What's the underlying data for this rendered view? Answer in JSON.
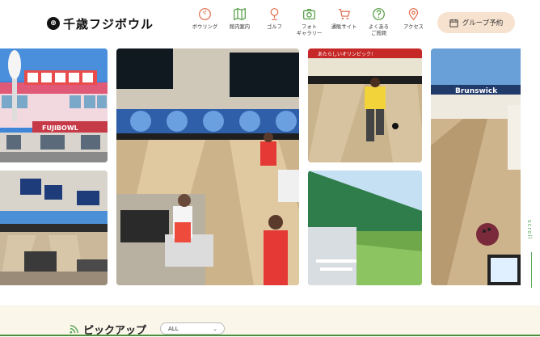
{
  "brand": {
    "name": "千歳フジボウル"
  },
  "nav": [
    {
      "label": "ボウリング",
      "icon": "bowling-ball-icon"
    },
    {
      "label": "館内案内",
      "icon": "map-icon"
    },
    {
      "label": "ゴルフ",
      "icon": "golf-icon"
    },
    {
      "label": "フォト\nギャラリー",
      "icon": "camera-icon"
    },
    {
      "label": "通販サイト",
      "icon": "cart-icon"
    },
    {
      "label": "よくある\nご質問",
      "icon": "question-icon"
    },
    {
      "label": "アクセス",
      "icon": "map-pin-icon"
    }
  ],
  "group_reservation": {
    "label": "グループ予約",
    "icon": "calendar-icon"
  },
  "gallery": {
    "signs": {
      "building": "FUJIBOWL",
      "banner": "あたらしいオリンピック!",
      "brand": "Brunswick"
    }
  },
  "scroll": {
    "label": "scroll"
  },
  "pickup": {
    "title": "ピックアップ",
    "filter_value": "ALL"
  },
  "colors": {
    "accent": "#5aa75a",
    "nav_icon": "#4e9a3c",
    "nav_icon_red": "#e06a4a",
    "button_bg": "#f7e2cf"
  }
}
